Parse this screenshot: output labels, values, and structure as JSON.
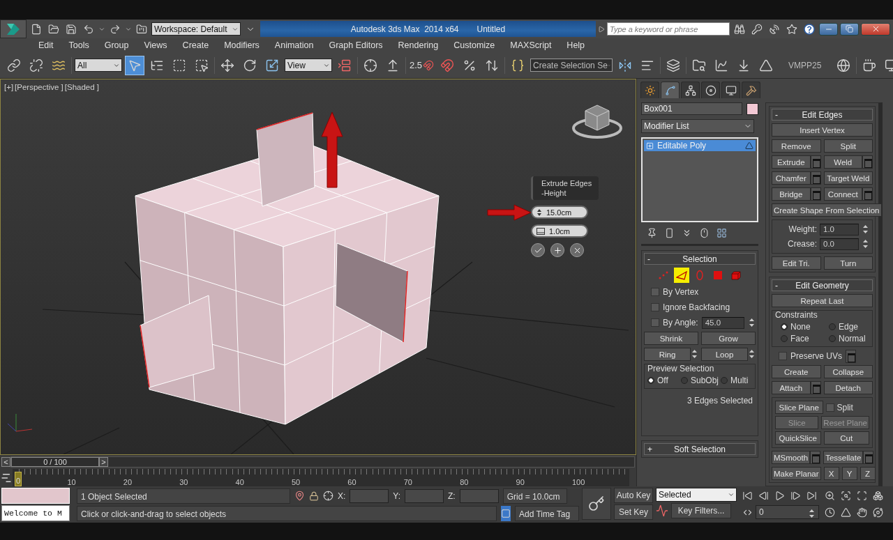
{
  "title_bar": {
    "workspace": "Workspace: Default",
    "title": "Autodesk 3ds Max  2014 x64",
    "document": "Untitled",
    "search": {
      "placeholder": "Type a keyword or phrase"
    }
  },
  "menu": [
    "Edit",
    "Tools",
    "Group",
    "Views",
    "Create",
    "Modifiers",
    "Animation",
    "Graph Editors",
    "Rendering",
    "Customize",
    "MAXScript",
    "Help"
  ],
  "toolbar": {
    "selection_filter": "All",
    "select_object_active": true,
    "reference_coord": "View",
    "snap_label": "2.5",
    "named_selection": "Create Selection Se",
    "label": "VMPP25"
  },
  "viewport": {
    "labels": [
      "[+]",
      "[Perspective ]",
      "[Shaded ]"
    ],
    "caddy": {
      "title": "Extrude Edges",
      "subtitle": "-Height",
      "height_value": "15.0cm",
      "width_value": "1.0cm"
    }
  },
  "command_panel": {
    "tabs": [
      {
        "kind": "create",
        "selected": false
      },
      {
        "kind": "modify",
        "selected": true
      },
      {
        "kind": "hierarchy",
        "selected": false
      },
      {
        "kind": "motion",
        "selected": false
      },
      {
        "kind": "display",
        "selected": false
      },
      {
        "kind": "utilities",
        "selected": false
      }
    ],
    "object_name": "Box001",
    "modifier_list": "Modifier List",
    "stack": [
      {
        "label": "Editable Poly",
        "selected": true
      }
    ],
    "selection": {
      "toggle": "-",
      "title": "Selection",
      "levels": [
        {
          "kind": "vertex",
          "selected": false
        },
        {
          "kind": "edge",
          "selected": true
        },
        {
          "kind": "border",
          "selected": false
        },
        {
          "kind": "polygon",
          "selected": false
        },
        {
          "kind": "element",
          "selected": false
        }
      ],
      "options": [
        {
          "label": "By Vertex",
          "checked": false
        },
        {
          "label": "Ignore Backfacing",
          "checked": false
        }
      ],
      "by_angle": {
        "label": "By Angle:",
        "checked": false,
        "value": "45.0"
      },
      "buttons": [
        "Shrink",
        "Grow"
      ],
      "spin_buttons": [
        "Ring",
        "Loop"
      ],
      "preview": {
        "title": "Preview Selection",
        "options": [
          {
            "label": "Off",
            "selected": true
          },
          {
            "label": "SubObj",
            "selected": false
          },
          {
            "label": "Multi",
            "selected": false
          }
        ]
      },
      "status": "3 Edges Selected"
    },
    "soft_selection": {
      "toggle": "+",
      "title": "Soft Selection"
    },
    "edit_edges": {
      "toggle": "-",
      "title": "Edit Edges",
      "rows": [
        [
          {
            "label": "Insert Vertex",
            "settings": false
          }
        ],
        [
          {
            "label": "Remove",
            "settings": false
          },
          {
            "label": "Split",
            "settings": false
          }
        ],
        [
          {
            "label": "Extrude",
            "settings": true
          },
          {
            "label": "Weld",
            "settings": true
          }
        ],
        [
          {
            "label": "Chamfer",
            "settings": true
          },
          {
            "label": "Target Weld",
            "settings": false
          }
        ],
        [
          {
            "label": "Bridge",
            "settings": true
          },
          {
            "label": "Connect",
            "settings": true
          }
        ],
        [
          {
            "label": "Create Shape From Selection",
            "settings": false
          }
        ]
      ],
      "weight": {
        "label": "Weight:",
        "value": "1.0"
      },
      "crease": {
        "label": "Crease:",
        "value": "0.0"
      },
      "bottom": [
        "Edit Tri.",
        "Turn"
      ]
    },
    "edit_geometry": {
      "toggle": "-",
      "title": "Edit Geometry",
      "repeat": "Repeat Last",
      "constraints": {
        "title": "Constraints",
        "options": [
          {
            "label": "None",
            "selected": true
          },
          {
            "label": "Edge",
            "selected": false
          },
          {
            "label": "Face",
            "selected": false
          },
          {
            "label": "Normal",
            "selected": false
          }
        ]
      },
      "preserve_uvs": {
        "label": "Preserve UVs",
        "checked": false
      },
      "rows": [
        [
          {
            "label": "Create",
            "settings": false
          },
          {
            "label": "Collapse",
            "settings": false
          }
        ],
        [
          {
            "label": "Attach",
            "settings": true
          },
          {
            "label": "Detach",
            "settings": false
          }
        ]
      ],
      "slice_plane": "Slice Plane",
      "split": {
        "label": "Split",
        "checked": false
      },
      "slice_rows": [
        [
          {
            "label": "Slice",
            "disabled": true
          },
          {
            "label": "Reset Plane",
            "disabled": true
          }
        ],
        [
          {
            "label": "QuickSlice",
            "disabled": false
          },
          {
            "label": "Cut",
            "disabled": false
          }
        ]
      ],
      "smooth_row": [
        {
          "label": "MSmooth",
          "settings": true
        },
        {
          "label": "Tessellate",
          "settings": true
        }
      ],
      "planar": "Make Planar",
      "axes": [
        "X",
        "Y",
        "Z"
      ]
    }
  },
  "timeline": {
    "prev": "<",
    "label": "0 / 100",
    "next": ">",
    "level": 0,
    "current_frame": "0",
    "ticks": [
      "10",
      "20",
      "30",
      "40",
      "50",
      "60",
      "70",
      "80",
      "90",
      "100"
    ]
  },
  "status_bar": {
    "listener": "Welcome to M",
    "prompt": "1 Object Selected",
    "hint": "Click or click-and-drag to select objects",
    "coords": [
      "X:",
      "Y:",
      "Z:"
    ],
    "grid": "Grid = 10.0cm",
    "time_tag": "Add Time Tag",
    "auto_key": "Auto Key",
    "set_key": "Set Key",
    "key_mode": "Selected",
    "key_filters": "Key Filters...",
    "frame": "0"
  }
}
